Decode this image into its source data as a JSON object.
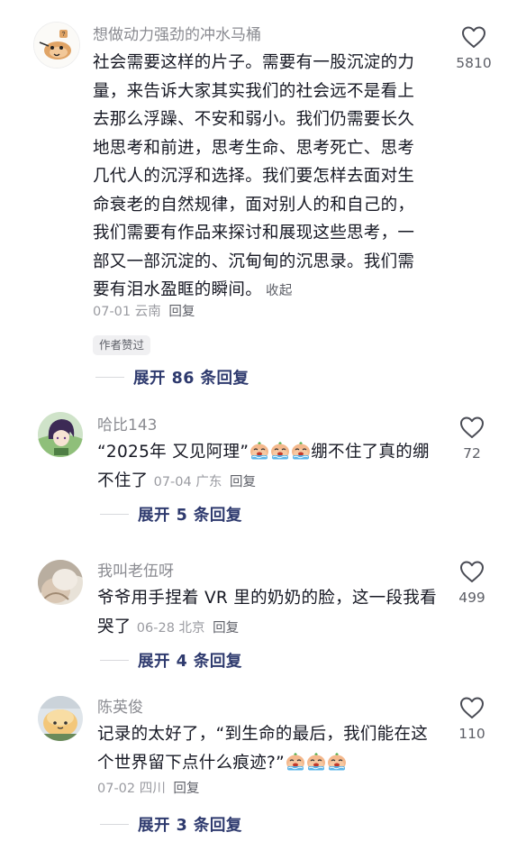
{
  "comments": [
    {
      "username": "想做动力强劲的冲水马桶",
      "lines": [
        "社会需要这样的片子。需要有一股沉淀的力",
        "量，来告诉大家其实我们的社会远不是看上",
        "去那么浮躁、不安和弱小。我们仍需要长久",
        "地思考和前进，思考生命、思考死亡、思考",
        "几代人的沉浮和选择。我们要怎样去面对生",
        "命衰老的自然规律，面对别人的和自己的，",
        "我们需要有作品来探讨和展现这些思考，一",
        "部又一部沉淀的、沉甸甸的沉思录。我们需",
        "要有泪水盈眶的瞬间。"
      ],
      "collapse_label": "收起",
      "date": "07-01",
      "location": "云南",
      "reply_label": "回复",
      "badge": "作者赞过",
      "likes": "5810",
      "expand_label": "展开 86 条回复"
    },
    {
      "username": "哈比143",
      "line1_prefix": "“2025年 又见阿理”",
      "line1_suffix": "绷不住了真的绷",
      "line2": "不住了",
      "date": "07-04",
      "location": "广东",
      "reply_label": "回复",
      "likes": "72",
      "expand_label": "展开 5 条回复"
    },
    {
      "username": "我叫老伍呀",
      "line1": "爷爷用手捏着 VR 里的奶奶的脸，这一段我看",
      "line2": "哭了",
      "date": "06-28",
      "location": "北京",
      "reply_label": "回复",
      "likes": "499",
      "expand_label": "展开 4 条回复"
    },
    {
      "username": "陈英俊",
      "line1": "记录的太好了，“到生命的最后，我们能在这",
      "line2": "个世界留下点什么痕迹?”",
      "date": "07-02",
      "location": "四川",
      "reply_label": "回复",
      "likes": "110",
      "expand_label": "展开 3 条回复"
    }
  ],
  "icons": {
    "like": "heart-outline-icon",
    "emoji": "crying-emoji-icon"
  },
  "colors": {
    "text": "#161823",
    "muted": "#8a8b91",
    "expand": "#2e3a6e"
  }
}
